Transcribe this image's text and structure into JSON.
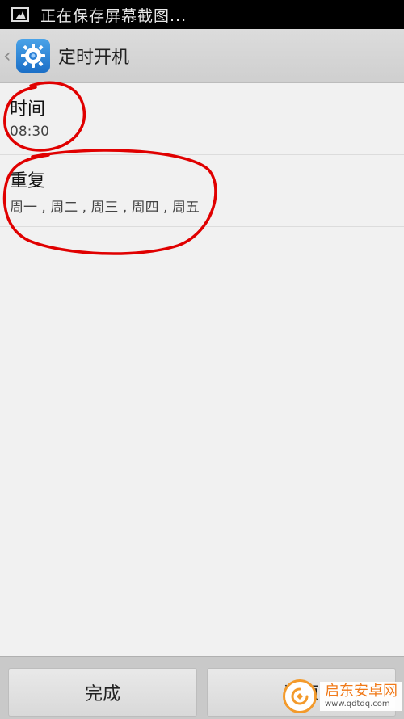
{
  "statusbar": {
    "notification_text": "正在保存屏幕截图..."
  },
  "actionbar": {
    "back_glyph": "《",
    "title": "定时开机"
  },
  "list": {
    "items": [
      {
        "title": "时间",
        "value": "08:30"
      },
      {
        "title": "重复",
        "value": "周一 , 周二 , 周三 , 周四 , 周五"
      }
    ]
  },
  "bottombar": {
    "done_label": "完成",
    "restore_label": "还原"
  },
  "watermark": {
    "name": "启东安卓网",
    "url": "www.qdtdq.com"
  },
  "colors": {
    "annotation": "#e00000",
    "accent": "#1b6fc7",
    "watermark": "#f07a1a"
  }
}
